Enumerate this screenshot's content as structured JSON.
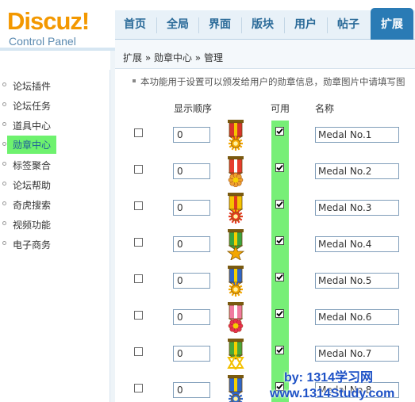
{
  "logo": {
    "brand": "Discuz!",
    "subtitle": "Control Panel"
  },
  "topnav": {
    "items": [
      "首页",
      "全局",
      "界面",
      "版块",
      "用户",
      "帖子",
      "扩展"
    ],
    "active_index": 6
  },
  "breadcrumb": "扩展 » 勋章中心 » 管理",
  "sidebar": {
    "items": [
      "论坛插件",
      "论坛任务",
      "道具中心",
      "勋章中心",
      "标签聚合",
      "论坛帮助",
      "奇虎搜索",
      "视频功能",
      "电子商务"
    ],
    "active_index": 3
  },
  "notice": "本功能用于设置可以颁发给用户的勋章信息，勋章图片中请填写图",
  "table": {
    "headers": {
      "order": "显示顺序",
      "available": "可用",
      "name": "名称"
    },
    "rows": [
      {
        "order": "0",
        "name": "Medal No.1",
        "available": true,
        "ribbon": "#d9342b",
        "stripe": "#f5c400",
        "medal": "#f3a600",
        "shape": "sun"
      },
      {
        "order": "0",
        "name": "Medal No.2",
        "available": true,
        "ribbon": "#e63b2e",
        "stripe": "#ffffff",
        "medal": "#f0a030",
        "shape": "flower"
      },
      {
        "order": "0",
        "name": "Medal No.3",
        "available": true,
        "ribbon": "#f5c400",
        "stripe": "#e03a20",
        "medal": "#e53a20",
        "shape": "sun"
      },
      {
        "order": "0",
        "name": "Medal No.4",
        "available": true,
        "ribbon": "#3aa540",
        "stripe": "#f5d000",
        "medal": "#f3a600",
        "shape": "star"
      },
      {
        "order": "0",
        "name": "Medal No.5",
        "available": true,
        "ribbon": "#2f66c8",
        "stripe": "#f5d000",
        "medal": "#f3a600",
        "shape": "sun"
      },
      {
        "order": "0",
        "name": "Medal No.6",
        "available": true,
        "ribbon": "#f07aa0",
        "stripe": "#ffffff",
        "medal": "#e83050",
        "shape": "flower"
      },
      {
        "order": "0",
        "name": "Medal No.7",
        "available": true,
        "ribbon": "#4aa83a",
        "stripe": "#f5d000",
        "medal": "#f3c000",
        "shape": "hexstar"
      },
      {
        "order": "0",
        "name": "Medal No.8",
        "available": true,
        "ribbon": "#2f66c8",
        "stripe": "#f5d000",
        "medal": "#2f66c8",
        "shape": "sun"
      }
    ]
  },
  "watermark": {
    "line1": "by: 1314学习网",
    "line2": "www.1314Study.com"
  },
  "colors": {
    "accent": "#2a7bb5",
    "highlight": "#77ef77",
    "brand": "#f39800"
  }
}
